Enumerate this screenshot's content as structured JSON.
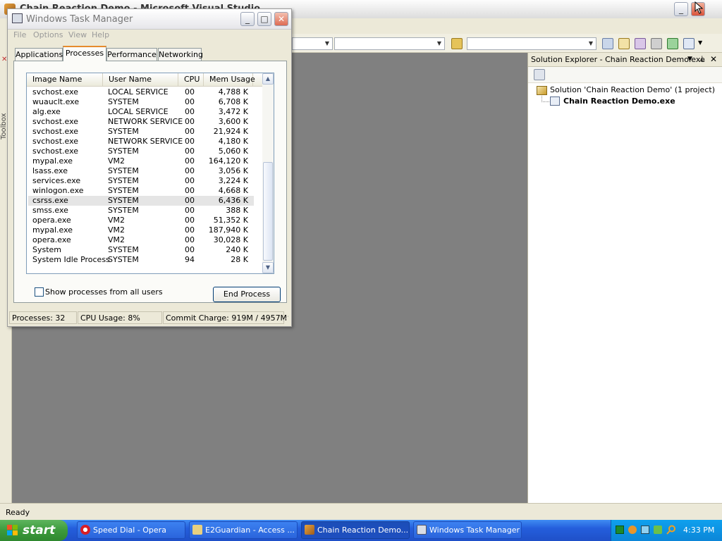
{
  "vs": {
    "title": "Chain Reaction Demo - Microsoft Visual Studio",
    "toolbox_label": "Toolbox",
    "status": "Ready",
    "solution_explorer": {
      "title": "Solution Explorer - Chain Reaction Demo.exe",
      "solution_node": "Solution 'Chain Reaction Demo' (1 project)",
      "project_node": "Chain Reaction Demo.exe"
    }
  },
  "task_manager": {
    "title": "Windows Task Manager",
    "menu": [
      "File",
      "Options",
      "View",
      "Help"
    ],
    "tabs": [
      {
        "label": "Applications",
        "active": false
      },
      {
        "label": "Processes",
        "active": true
      },
      {
        "label": "Performance",
        "active": false
      },
      {
        "label": "Networking",
        "active": false
      }
    ],
    "columns": [
      "Image Name",
      "User Name",
      "CPU",
      "Mem Usage"
    ],
    "processes": [
      {
        "name": "svchost.exe",
        "user": "LOCAL SERVICE",
        "cpu": "00",
        "mem": "4,788 K"
      },
      {
        "name": "wuauclt.exe",
        "user": "SYSTEM",
        "cpu": "00",
        "mem": "6,708 K"
      },
      {
        "name": "alg.exe",
        "user": "LOCAL SERVICE",
        "cpu": "00",
        "mem": "3,472 K"
      },
      {
        "name": "svchost.exe",
        "user": "NETWORK SERVICE",
        "cpu": "00",
        "mem": "3,600 K"
      },
      {
        "name": "svchost.exe",
        "user": "SYSTEM",
        "cpu": "00",
        "mem": "21,924 K"
      },
      {
        "name": "svchost.exe",
        "user": "NETWORK SERVICE",
        "cpu": "00",
        "mem": "4,180 K"
      },
      {
        "name": "svchost.exe",
        "user": "SYSTEM",
        "cpu": "00",
        "mem": "5,060 K"
      },
      {
        "name": "mypal.exe",
        "user": "VM2",
        "cpu": "00",
        "mem": "164,120 K"
      },
      {
        "name": "lsass.exe",
        "user": "SYSTEM",
        "cpu": "00",
        "mem": "3,056 K"
      },
      {
        "name": "services.exe",
        "user": "SYSTEM",
        "cpu": "00",
        "mem": "3,224 K"
      },
      {
        "name": "winlogon.exe",
        "user": "SYSTEM",
        "cpu": "00",
        "mem": "4,668 K"
      },
      {
        "name": "csrss.exe",
        "user": "SYSTEM",
        "cpu": "00",
        "mem": "6,436 K",
        "selected": true
      },
      {
        "name": "smss.exe",
        "user": "SYSTEM",
        "cpu": "00",
        "mem": "388 K"
      },
      {
        "name": "opera.exe",
        "user": "VM2",
        "cpu": "00",
        "mem": "51,352 K"
      },
      {
        "name": "mypal.exe",
        "user": "VM2",
        "cpu": "00",
        "mem": "187,940 K"
      },
      {
        "name": "opera.exe",
        "user": "VM2",
        "cpu": "00",
        "mem": "30,028 K"
      },
      {
        "name": "System",
        "user": "SYSTEM",
        "cpu": "00",
        "mem": "240 K"
      },
      {
        "name": "System Idle Process",
        "user": "SYSTEM",
        "cpu": "94",
        "mem": "28 K"
      }
    ],
    "show_all_label": "Show processes from all users",
    "end_process_label": "End Process",
    "status": {
      "processes": "Processes: 32",
      "cpu": "CPU Usage: 8%",
      "commit": "Commit Charge: 919M / 4957M"
    }
  },
  "taskbar": {
    "start_label": "start",
    "buttons": [
      {
        "label": "Speed Dial - Opera",
        "icon": "opera-icon",
        "active": false
      },
      {
        "label": "E2Guardian - Access ...",
        "icon": "e2guardian-icon",
        "active": false
      },
      {
        "label": "Chain Reaction Demo...",
        "icon": "visual-studio-icon",
        "active": true
      },
      {
        "label": "Windows Task Manager",
        "icon": "task-manager-icon",
        "active": false
      }
    ],
    "clock": "4:33 PM"
  },
  "colors": {
    "taskbar_blue": "#245edc",
    "start_green": "#3c9a3c",
    "tab_accent": "#e68b2c",
    "editor_gray": "#808080"
  }
}
